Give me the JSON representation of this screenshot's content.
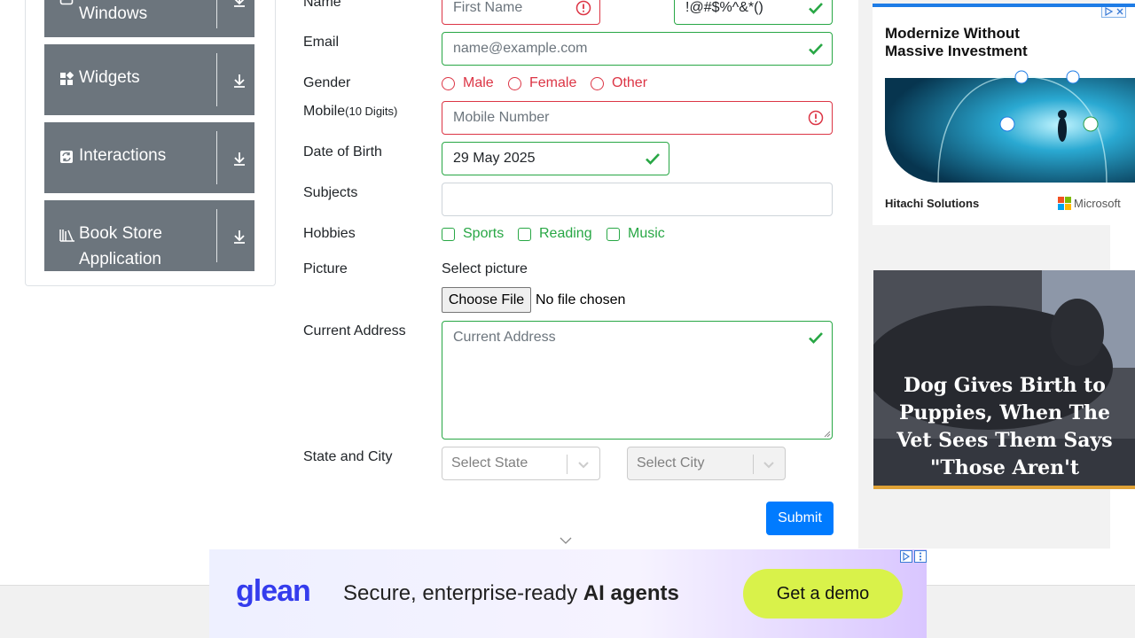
{
  "sidebar": {
    "groups": [
      {
        "label": "Alerts, Frame & Windows",
        "icon": "window-icon"
      },
      {
        "label": "Widgets",
        "icon": "widgets-icon"
      },
      {
        "label": "Interactions",
        "icon": "interactions-icon"
      },
      {
        "label": "Book Store Application",
        "icon": "books-icon"
      }
    ]
  },
  "form": {
    "name_label": "Name",
    "first_name_placeholder": "First Name",
    "last_name_value": "!@#$%^&*()",
    "email_label": "Email",
    "email_placeholder": "name@example.com",
    "gender_label": "Gender",
    "gender_options": [
      "Male",
      "Female",
      "Other"
    ],
    "mobile_label": "Mobile",
    "mobile_hint": "(10 Digits)",
    "mobile_placeholder": "Mobile Number",
    "dob_label": "Date of Birth",
    "dob_value": "29 May 2025",
    "subjects_label": "Subjects",
    "hobbies_label": "Hobbies",
    "hobbies_options": [
      "Sports",
      "Reading",
      "Music"
    ],
    "picture_label": "Picture",
    "select_picture_label": "Select picture",
    "choose_file_label": "Choose File",
    "no_file_text": "No file chosen",
    "address_label": "Current Address",
    "address_placeholder": "Current Address",
    "state_city_label": "State and City",
    "state_placeholder": "Select State",
    "city_placeholder": "Select City",
    "submit_label": "Submit"
  },
  "ads": {
    "right_top": {
      "headline": "Modernize Without Massive Investment",
      "sponsor": "Hitachi Solutions",
      "partner": "Microsoft"
    },
    "right_bottom": {
      "headline": "Dog Gives Birth to Puppies, When The Vet Sees Them Says \"Those Aren't Puppies\""
    },
    "bottom": {
      "brand": "glean",
      "text_plain": "Secure, enterprise-ready ",
      "text_bold": "AI agents",
      "cta": "Get a demo"
    }
  },
  "colors": {
    "valid": "#28a745",
    "invalid": "#dc3545",
    "primary": "#007bff",
    "sidebar_group": "#6c757d",
    "cta_bg": "#d9f24a"
  }
}
